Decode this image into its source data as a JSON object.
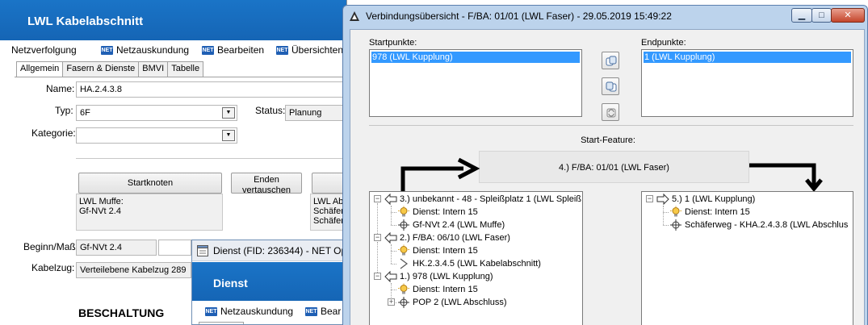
{
  "background_window": {
    "title": "LWL Kabelabschnitt",
    "menu": [
      "Netzverfolgung",
      "Netzauskundung",
      "Bearbeiten",
      "Übersichten"
    ],
    "net_badge": "NET",
    "tabs": [
      "Allgemein",
      "Fasern & Dienste",
      "BMVI",
      "Tabelle"
    ],
    "form": {
      "name_label": "Name:",
      "name_value": "HA.2.4.3.8",
      "typ_label": "Typ:",
      "typ_value": "6F",
      "status_label": "Status:",
      "status_value": "Planung",
      "kategorie_label": "Kategorie:",
      "kategorie_value": "",
      "startknoten_button": "Startknoten",
      "enden_button_line1": "Enden",
      "enden_button_line2": "vertauschen",
      "start_node_info": "LWL Muffe:\nGf-NVt 2.4",
      "end_node_info": "LWL Ab\nSchäfer\nSchäfer",
      "beginn_label": "Beginn/Maß:",
      "beginn_value": "Gf-NVt 2.4",
      "kabelzug_label": "Kabelzug:",
      "kabelzug_value": "Verteilebene Kabelzug 289",
      "section_heading": "BESCHALTUNG"
    }
  },
  "dienst_window": {
    "title": "Dienst (FID: 236344) - NET Op",
    "header": "Dienst",
    "menu": [
      "Netzauskundung",
      "Bear"
    ]
  },
  "dialog": {
    "title": "Verbindungsübersicht - F/BA: 01/01 (LWL Faser) - 29.05.2019 15:49:22",
    "caption_buttons": {
      "minimize": "▁",
      "maximize": "□",
      "close": "✕"
    },
    "startpunkte_label": "Startpunkte:",
    "startpunkte_items": [
      "978 (LWL Kupplung)"
    ],
    "endpunkte_label": "Endpunkte:",
    "endpunkte_items": [
      "1 (LWL Kupplung)"
    ],
    "start_feature_label": "Start-Feature:",
    "start_feature_value": "4.) F/BA: 01/01 (LWL Faser)",
    "left_tree": [
      {
        "text": "3.) unbekannt - 48 - Spleißplatz 1 (LWL Spleiß",
        "icon": "arrow-left-icon"
      },
      {
        "text": "Dienst: Intern 15",
        "icon": "bulb-icon"
      },
      {
        "text": "Gf-NVt 2.4 (LWL Muffe)",
        "icon": "crosshair-icon"
      },
      {
        "text": "2.) F/BA: 06/10 (LWL Faser)",
        "icon": "arrow-left-icon"
      },
      {
        "text": "Dienst: Intern 15",
        "icon": "bulb-icon"
      },
      {
        "text": "HK.2.3.4.5 (LWL Kabelabschnitt)",
        "icon": "cable-icon"
      },
      {
        "text": "1.) 978 (LWL Kupplung)",
        "icon": "arrow-left-icon"
      },
      {
        "text": "Dienst: Intern 15",
        "icon": "bulb-icon"
      },
      {
        "text": "POP 2 (LWL Abschluss)",
        "icon": "crosshair-icon"
      }
    ],
    "right_tree": [
      {
        "text": "5.) 1 (LWL Kupplung)",
        "icon": "arrow-right-icon"
      },
      {
        "text": "Dienst: Intern 15",
        "icon": "bulb-icon"
      },
      {
        "text": "Schäferweg - KHA.2.4.3.8 (LWL Abschlus",
        "icon": "crosshair-icon"
      }
    ],
    "colors": {
      "frame": "#bcd3ec",
      "selection": "#3399ff",
      "flow_arrow": "#000000"
    }
  }
}
